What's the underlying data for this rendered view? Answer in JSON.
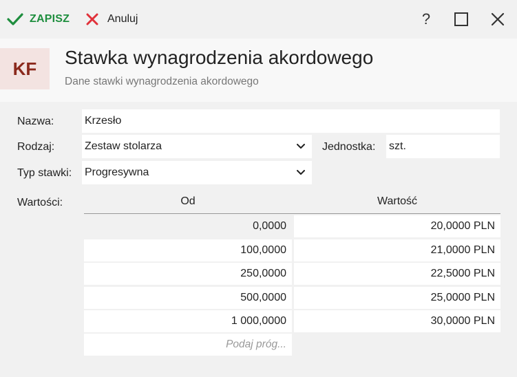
{
  "toolbar": {
    "save_label": "ZAPISZ",
    "cancel_label": "Anuluj",
    "help_label": "?"
  },
  "header": {
    "avatar_text": "KF",
    "title": "Stawka wynagrodzenia akordowego",
    "subtitle": "Dane stawki wynagrodzenia akordowego"
  },
  "form": {
    "nazwa": {
      "label": "Nazwa:",
      "value": "Krzesło"
    },
    "rodzaj": {
      "label": "Rodzaj:",
      "value": "Zestaw stolarza"
    },
    "jednostka": {
      "label": "Jednostka:",
      "value": "szt."
    },
    "typ_stawki": {
      "label": "Typ stawki:",
      "value": "Progresywna"
    },
    "wartosci": {
      "label": "Wartości:"
    }
  },
  "table": {
    "columns": [
      "Od",
      "Wartość"
    ],
    "rows": [
      {
        "od": "0,0000",
        "wartosc": "20,0000 PLN"
      },
      {
        "od": "100,0000",
        "wartosc": "21,0000 PLN"
      },
      {
        "od": "250,0000",
        "wartosc": "22,5000 PLN"
      },
      {
        "od": "500,0000",
        "wartosc": "25,0000 PLN"
      },
      {
        "od": "1 000,0000",
        "wartosc": "30,0000 PLN"
      }
    ],
    "new_row_placeholder": "Podaj próg..."
  },
  "colors": {
    "accent_green": "#1e8e3e",
    "cancel_red": "#e0313a",
    "avatar_bg": "#f3e3e1",
    "avatar_fg": "#8b2a1d"
  }
}
